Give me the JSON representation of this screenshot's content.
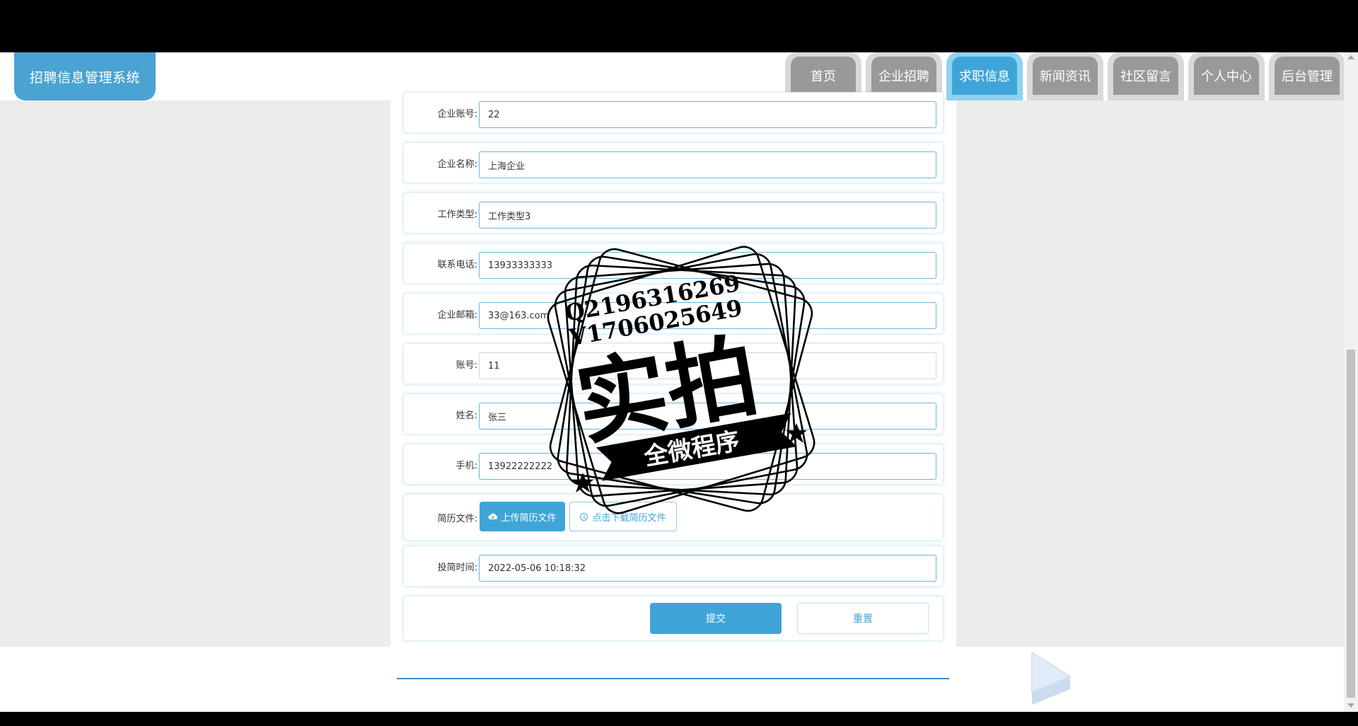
{
  "header": {
    "app_title": "招聘信息管理系统",
    "nav": [
      {
        "label": "首页",
        "active": false
      },
      {
        "label": "企业招聘",
        "active": false
      },
      {
        "label": "求职信息",
        "active": true
      },
      {
        "label": "新闻资讯",
        "active": false
      },
      {
        "label": "社区留言",
        "active": false
      },
      {
        "label": "个人中心",
        "active": false
      },
      {
        "label": "后台管理",
        "active": false
      }
    ]
  },
  "form": {
    "fields": [
      {
        "label": "企业账号:",
        "value": "22"
      },
      {
        "label": "企业名称:",
        "value": "上海企业"
      },
      {
        "label": "工作类型:",
        "value": "工作类型3"
      },
      {
        "label": "联系电话:",
        "value": "13933333333"
      },
      {
        "label": "企业邮箱:",
        "value": "33@163.com"
      },
      {
        "label": "账号:",
        "value": "11"
      },
      {
        "label": "姓名:",
        "value": "张三"
      },
      {
        "label": "手机:",
        "value": "13922222222"
      }
    ],
    "resume": {
      "label": "简历文件:",
      "upload_label": "上传简历文件",
      "download_label": "点击下载简历文件"
    },
    "submit_time": {
      "label": "投简时间:",
      "value": "2022-05-06 10:18:32"
    },
    "submit_label": "提交",
    "reset_label": "重置"
  },
  "watermark": {
    "line1": "Q2196316269",
    "line2": "V1706025649",
    "big_text": "实拍",
    "ribbon_text": "全微程序"
  },
  "colors": {
    "accent": "#3fa5d9",
    "nav_inactive": "#999999",
    "background": "#ececec"
  }
}
